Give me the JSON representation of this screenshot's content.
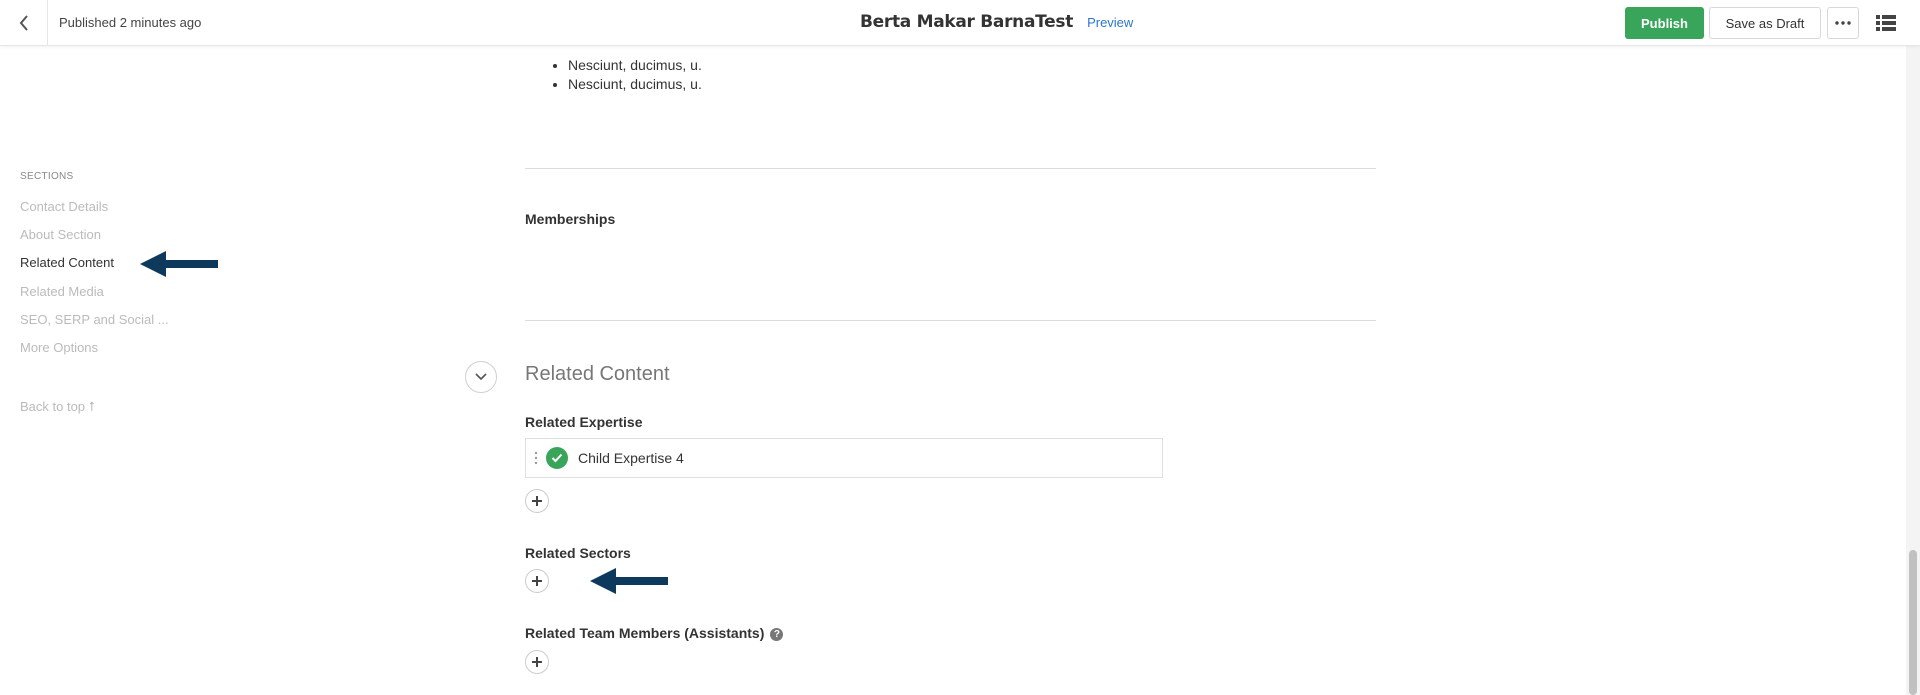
{
  "header": {
    "published_status": "Published 2 minutes ago",
    "title": "Berta Makar BarnaTest",
    "preview_label": "Preview",
    "publish_label": "Publish",
    "save_draft_label": "Save as Draft",
    "more_icon": "more-horizontal-icon",
    "list_icon": "list-view-icon",
    "back_icon": "chevron-left-icon"
  },
  "sidebar": {
    "heading": "SECTIONS",
    "items": [
      {
        "label": "Contact Details",
        "active": false
      },
      {
        "label": "About Section",
        "active": false
      },
      {
        "label": "Related Content",
        "active": true
      },
      {
        "label": "Related Media",
        "active": false
      },
      {
        "label": "SEO, SERP and Social ...",
        "active": false
      },
      {
        "label": "More Options",
        "active": false
      }
    ],
    "back_to_top": "Back to top ⭡"
  },
  "content": {
    "bullets": [
      "Nesciunt, ducimus, u.",
      "Nesciunt, ducimus, u."
    ],
    "memberships_label": "Memberships",
    "section_title": "Related Content",
    "related_expertise": {
      "label": "Related Expertise",
      "items": [
        {
          "text": "Child Expertise 4",
          "status": "published"
        }
      ]
    },
    "related_sectors_label": "Related Sectors",
    "related_team_label": "Related Team Members (Assistants)",
    "help_glyph": "?"
  },
  "colors": {
    "accent_green": "#38a55a",
    "link_blue": "#2c76c9",
    "annotation_arrow": "#0d3a5c"
  }
}
